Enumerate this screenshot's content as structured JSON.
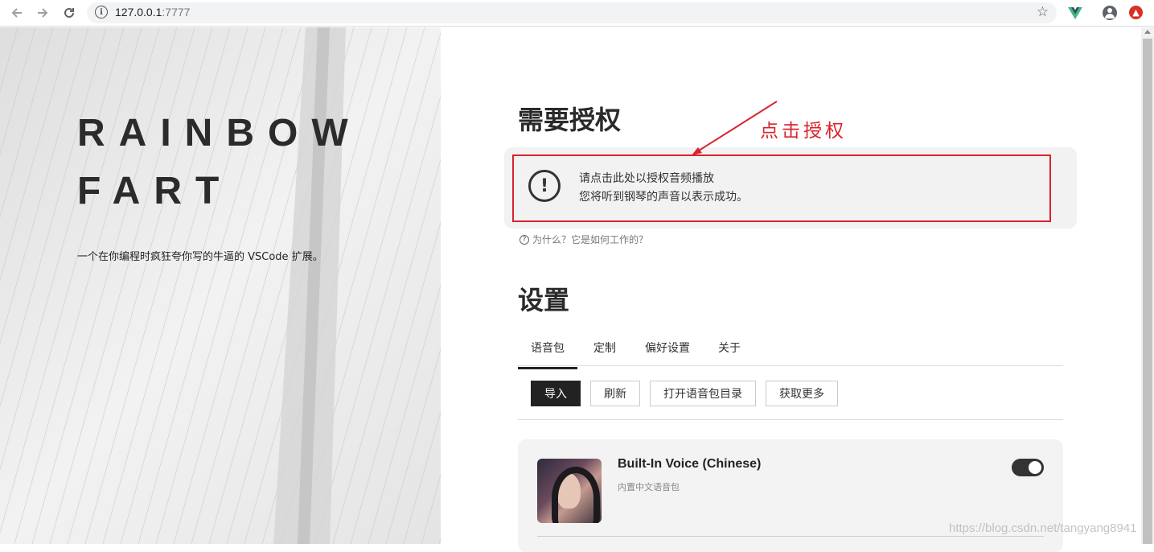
{
  "browser": {
    "url_host": "127.0.0.1",
    "url_port": ":7777",
    "icons": [
      "back-arrow-icon",
      "forward-arrow-icon",
      "reload-icon",
      "info-icon",
      "star-icon",
      "vue-devtools-icon",
      "account-icon",
      "extension-red-icon"
    ]
  },
  "hero": {
    "title_line1": "RAINBOW",
    "title_line2": "FART",
    "description": "一个在你编程时疯狂夸你写的牛逼的 VSCode 扩展。"
  },
  "auth": {
    "heading": "需要授权",
    "line1": "请点击此处以授权音频播放",
    "line2": "您将听到钢琴的声音以表示成功。",
    "icon_glyph": "!",
    "why_text": "为什么？它是如何工作的？",
    "why_icon_glyph": "?"
  },
  "annotation": {
    "text": "点击授权",
    "color": "#d9232d"
  },
  "settings": {
    "heading": "设置",
    "tabs": [
      {
        "label": "语音包",
        "active": true
      },
      {
        "label": "定制",
        "active": false
      },
      {
        "label": "偏好设置",
        "active": false
      },
      {
        "label": "关于",
        "active": false
      }
    ],
    "buttons": {
      "import": "导入",
      "refresh": "刷新",
      "open_dir": "打开语音包目录",
      "get_more": "获取更多"
    }
  },
  "voice_pack": {
    "name": "Built-In Voice (Chinese)",
    "description": "内置中文语音包",
    "enabled": true
  },
  "watermark": "https://blog.csdn.net/tangyang8941"
}
